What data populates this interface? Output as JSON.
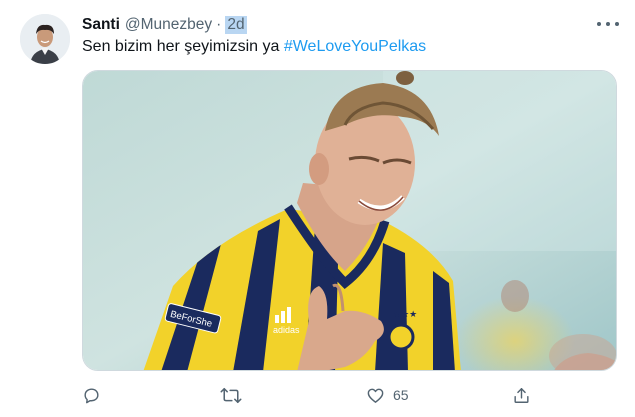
{
  "tweet": {
    "author": {
      "name": "Santi",
      "handle": "@Munezbey"
    },
    "separator": "·",
    "timestamp": "2d",
    "text": {
      "body": "Sen bizim her şeyimizsin ya ",
      "hashtag": "#WeLoveYouPelkas"
    },
    "media": {
      "jersey_sponsor": "adidas",
      "sleeve_badge": "BeForShe"
    },
    "actions": {
      "reply_icon": "reply-icon",
      "retweet_icon": "retweet-icon",
      "like_icon": "heart-icon",
      "like_count": "65",
      "share_icon": "share-icon"
    }
  },
  "colors": {
    "accent": "#1d9bf0",
    "secondary_text": "#536471",
    "time_highlight": "#b9d6f2",
    "jersey_yellow": "#f2d22a",
    "jersey_navy": "#1a2a5e"
  }
}
